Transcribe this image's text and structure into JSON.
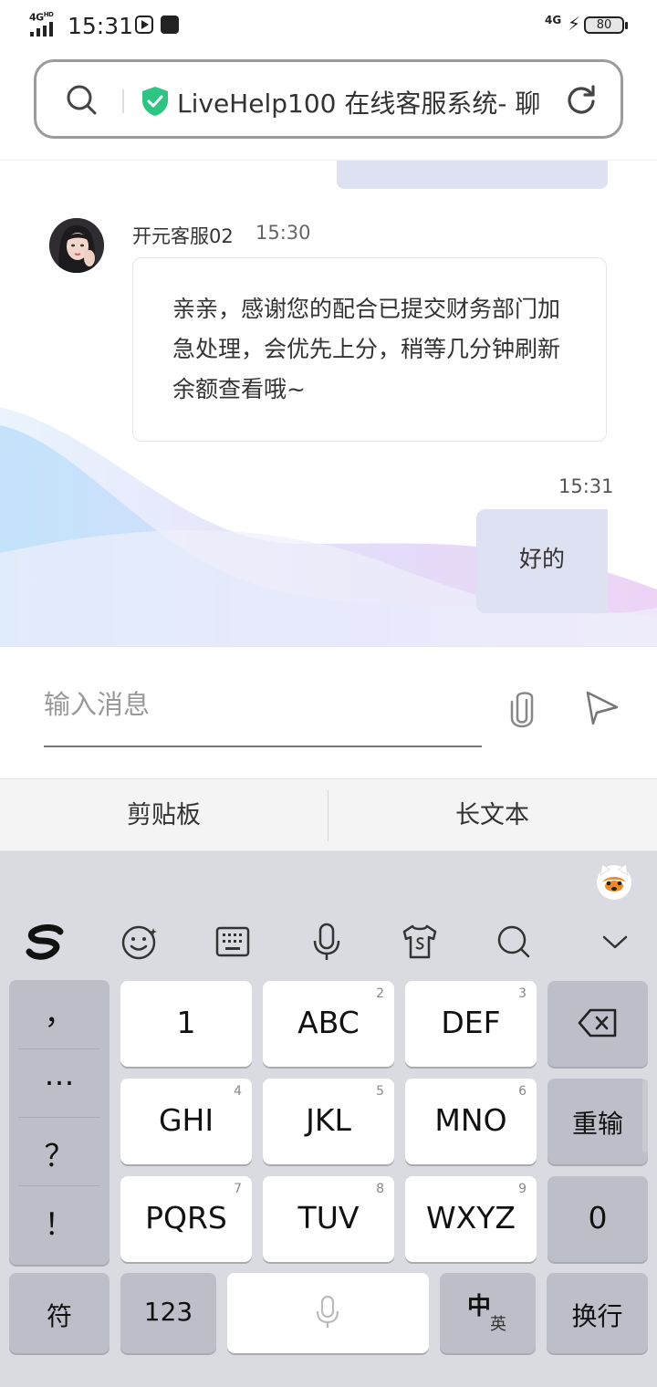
{
  "status_bar": {
    "network": "4G",
    "network_hd": "HD",
    "time": "15:31",
    "network_right": "4G",
    "battery": "80"
  },
  "address_bar": {
    "title": "LiveHelp100 在线客服系统- 聊",
    "accent": "#2ec482"
  },
  "chat": {
    "agent_name": "开元客服02",
    "agent_time": "15:30",
    "agent_message": "亲亲，感谢您的配合已提交财务部门加急处理，会优先上分，稍等几分钟刷新余额查看哦~",
    "my_time": "15:31",
    "my_message": "好的",
    "my_bubble_color": "#dde1f1"
  },
  "input": {
    "placeholder": "输入消息",
    "attach_icon": "paperclip-icon",
    "send_icon": "send-icon"
  },
  "clipboard_bar": {
    "left": "剪贴板",
    "right": "长文本"
  },
  "keyboard": {
    "toolbar": [
      "sogou-logo-icon",
      "emoji-icon",
      "keyboard-icon",
      "microphone-icon",
      "skin-icon",
      "search-icon",
      "collapse-icon"
    ],
    "punct": [
      "，",
      "…",
      "？",
      "！"
    ],
    "keys": [
      {
        "label": "1",
        "num": ""
      },
      {
        "label": "ABC",
        "num": "2"
      },
      {
        "label": "DEF",
        "num": "3"
      },
      {
        "label": "GHI",
        "num": "4"
      },
      {
        "label": "JKL",
        "num": "5"
      },
      {
        "label": "MNO",
        "num": "6"
      },
      {
        "label": "PQRS",
        "num": "7"
      },
      {
        "label": "TUV",
        "num": "8"
      },
      {
        "label": "WXYZ",
        "num": "9"
      }
    ],
    "reinput": "重输",
    "zero": "0",
    "symbol": "符",
    "numeric": "123",
    "lang_main": "中",
    "lang_sub": "英",
    "enter": "换行"
  }
}
